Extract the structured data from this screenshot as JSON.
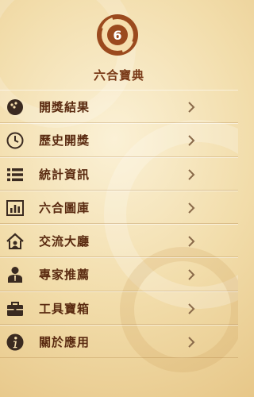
{
  "header": {
    "logo_icon": "lottery-ball-logo-icon",
    "logo_number": "6",
    "title": "六合寶典"
  },
  "menu": {
    "items": [
      {
        "label": "開獎結果",
        "icon": "ball-icon"
      },
      {
        "label": "歷史開獎",
        "icon": "clock-icon"
      },
      {
        "label": "統計資訊",
        "icon": "list-icon"
      },
      {
        "label": "六合圖庫",
        "icon": "chart-icon"
      },
      {
        "label": "交流大廳",
        "icon": "home-chat-icon"
      },
      {
        "label": "專家推薦",
        "icon": "expert-icon"
      },
      {
        "label": "工具寶箱",
        "icon": "toolbox-icon"
      },
      {
        "label": "關於應用",
        "icon": "info-icon"
      }
    ]
  },
  "colors": {
    "accent": "#7a3a18",
    "text": "#5a2a10",
    "icon": "#3a2a20",
    "chevron": "#8a6a4a"
  }
}
